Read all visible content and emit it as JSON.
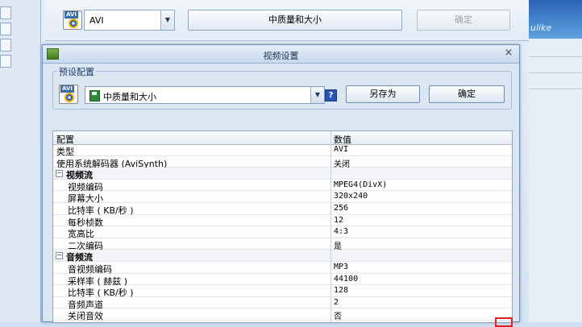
{
  "background": {
    "format_value": "AVI",
    "preset_button": "中质量和大小",
    "ok_button": "确定",
    "ghost_text": "ulike"
  },
  "dialog": {
    "title": "视频设置",
    "close_glyph": "×",
    "preset_group": {
      "legend": "预设配置",
      "selected": "中质量和大小",
      "help_glyph": "?",
      "save_as": "另存为",
      "confirm": "确定"
    },
    "grid": {
      "headers": [
        "配置",
        "数值"
      ],
      "rows": [
        {
          "key": "类型",
          "value": "AVI",
          "kind": "top"
        },
        {
          "key": "使用系统解码器 (AviSynth)",
          "value": "关闭",
          "kind": "top"
        },
        {
          "key": "视频流",
          "value": "",
          "kind": "category",
          "expander": "−"
        },
        {
          "key": "视频编码",
          "value": "MPEG4(DivX)",
          "kind": "child"
        },
        {
          "key": "屏幕大小",
          "value": "320x240",
          "kind": "child"
        },
        {
          "key": "比特率 ( KB/秒 )",
          "value": "256",
          "kind": "child"
        },
        {
          "key": "每秒桢数",
          "value": "12",
          "kind": "child"
        },
        {
          "key": "宽高比",
          "value": "4:3",
          "kind": "child"
        },
        {
          "key": "二次编码",
          "value": "是",
          "kind": "child"
        },
        {
          "key": "音频流",
          "value": "",
          "kind": "category",
          "expander": "−"
        },
        {
          "key": "音视频编码",
          "value": "MP3",
          "kind": "child"
        },
        {
          "key": "采样率 ( 赫兹 )",
          "value": "44100",
          "kind": "child"
        },
        {
          "key": "比特率 ( KB/秒 )",
          "value": "128",
          "kind": "child"
        },
        {
          "key": "音频声道",
          "value": "2",
          "kind": "child"
        },
        {
          "key": "关闭音效",
          "value": "否",
          "kind": "child"
        }
      ]
    }
  },
  "icons": {
    "avi_label": "AVI"
  },
  "colors": {
    "accent_blue": "#2a55b8",
    "highlight_red": "#e0231c"
  }
}
